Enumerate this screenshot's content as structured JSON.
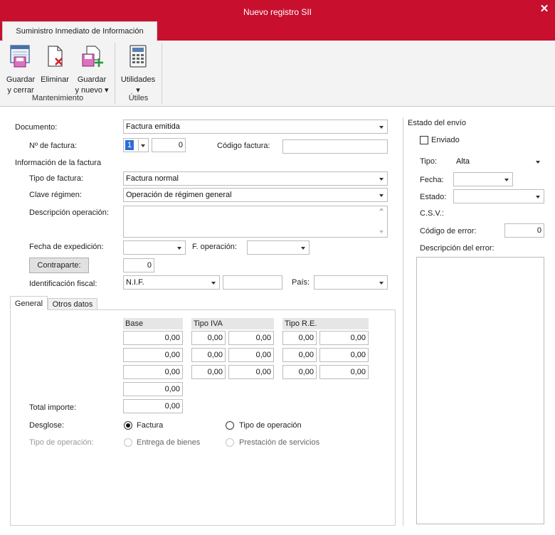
{
  "window": {
    "title": "Nuevo registro SII",
    "close_glyph": "✕"
  },
  "ribbon": {
    "tab": "Suministro Inmediato de Información",
    "buttons": {
      "save_close": {
        "line1": "Guardar",
        "line2": "y cerrar"
      },
      "delete": {
        "line1": "Eliminar"
      },
      "save_new": {
        "line1": "Guardar",
        "line2": "y nuevo ▾"
      },
      "utilities": {
        "line1": "Utilidades",
        "line2": "▾"
      }
    },
    "groups": {
      "maintenance": "Mantenimiento",
      "utils": "Útiles"
    }
  },
  "form": {
    "document_label": "Documento:",
    "document_value": "Factura emitida",
    "invoice_number_label": "Nº de factura:",
    "invoice_series": "1",
    "invoice_number": "0",
    "invoice_code_label": "Código factura:",
    "invoice_code_value": "",
    "invoice_info_heading": "Información de la factura",
    "invoice_type_label": "Tipo de factura:",
    "invoice_type_value": "Factura normal",
    "regime_key_label": "Clave régimen:",
    "regime_key_value": "Operación de régimen general",
    "op_description_label": "Descripción operación:",
    "op_description_value": "",
    "issue_date_label": "Fecha de expedición:",
    "op_date_label": "F. operación:",
    "counterpart_button": "Contraparte:",
    "counterpart_value": "0",
    "tax_id_label": "Identificación fiscal:",
    "tax_id_type": "N.I.F.",
    "tax_id_value": "",
    "country_label": "País:",
    "country_value": ""
  },
  "tabs": {
    "general": "General",
    "other": "Otros datos"
  },
  "grid": {
    "headers": {
      "base": "Base",
      "iva": "Tipo IVA",
      "re": "Tipo R.E."
    },
    "rows": [
      [
        "0,00",
        "0,00",
        "0,00",
        "0,00",
        "0,00"
      ],
      [
        "0,00",
        "0,00",
        "0,00",
        "0,00",
        "0,00"
      ],
      [
        "0,00",
        "0,00",
        "0,00",
        "0,00",
        "0,00"
      ]
    ],
    "base_total": "0,00",
    "total_label": "Total importe:",
    "total_value": "0,00"
  },
  "breakdown": {
    "label": "Desglose:",
    "opt_invoice": "Factura",
    "opt_operation_type": "Tipo de operación",
    "op_type_label": "Tipo de operación:",
    "opt_goods": "Entrega de bienes",
    "opt_services": "Prestación de servicios",
    "selected": "Factura"
  },
  "status_panel": {
    "heading": "Estado del envío",
    "sent_label": "Enviado",
    "sent_checked": false,
    "type_label": "Tipo:",
    "type_value": "Alta",
    "date_label": "Fecha:",
    "state_label": "Estado:",
    "csv_label": "C.S.V.:",
    "error_code_label": "Código de error:",
    "error_code_value": "0",
    "error_desc_label": "Descripción del error:"
  },
  "colors": {
    "brand": "#c8102e",
    "ribbon_bg": "#f3f3f3"
  }
}
